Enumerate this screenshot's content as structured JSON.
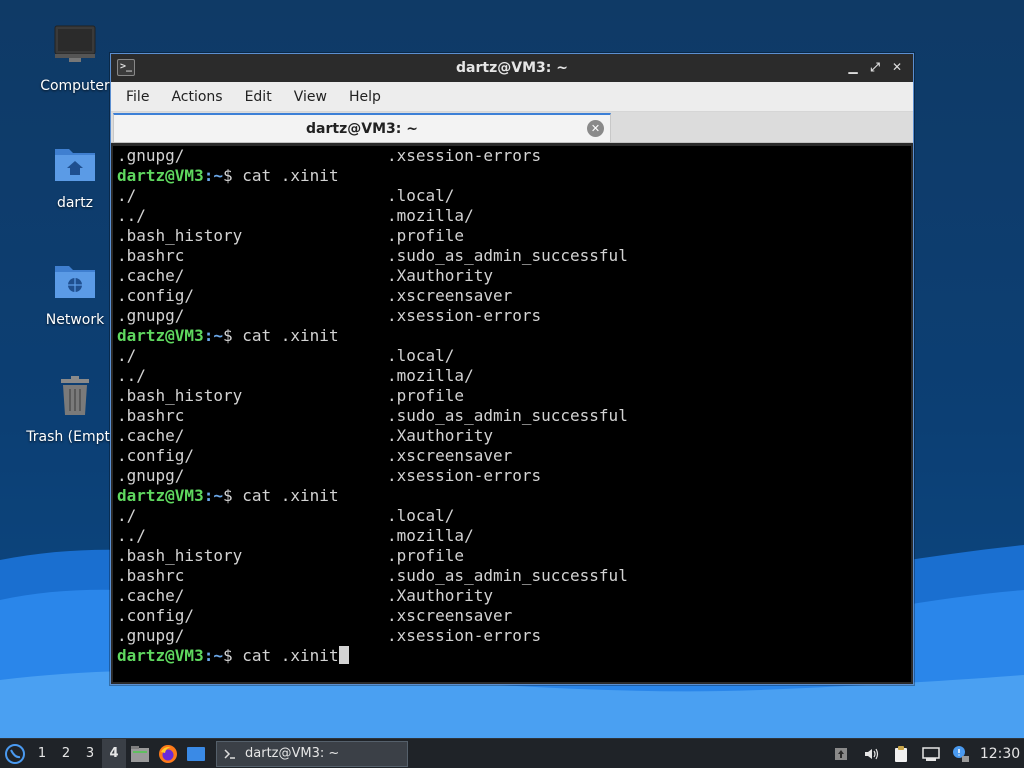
{
  "desktop": {
    "icons": [
      {
        "label": "Computer",
        "icon": "computer-icon"
      },
      {
        "label": "dartz",
        "icon": "home-folder-icon"
      },
      {
        "label": "Network",
        "icon": "network-folder-icon"
      },
      {
        "label": "Trash (Empty)",
        "icon": "trash-icon"
      }
    ]
  },
  "window": {
    "title": "dartz@VM3: ~",
    "buttons": {
      "minimize": "▁",
      "maximize": "⤢",
      "close": "✕"
    },
    "menu": [
      "File",
      "Actions",
      "Edit",
      "View",
      "Help"
    ],
    "tab": {
      "label": "dartz@VM3: ~",
      "close": "✕"
    }
  },
  "terminal": {
    "prompt_user": "dartz@VM3",
    "prompt_path": ":~",
    "prompt_symbol": "$",
    "command": " cat .xinit",
    "lines": [
      {
        "type": "out",
        "c1": ".gnupg/",
        "c2": ".xsession-errors"
      },
      {
        "type": "prompt"
      },
      {
        "type": "out",
        "c1": "./",
        "c2": ".local/"
      },
      {
        "type": "out",
        "c1": "../",
        "c2": ".mozilla/"
      },
      {
        "type": "out",
        "c1": ".bash_history",
        "c2": ".profile"
      },
      {
        "type": "out",
        "c1": ".bashrc",
        "c2": ".sudo_as_admin_successful"
      },
      {
        "type": "out",
        "c1": ".cache/",
        "c2": ".Xauthority"
      },
      {
        "type": "out",
        "c1": ".config/",
        "c2": ".xscreensaver"
      },
      {
        "type": "out",
        "c1": ".gnupg/",
        "c2": ".xsession-errors"
      },
      {
        "type": "prompt"
      },
      {
        "type": "out",
        "c1": "./",
        "c2": ".local/"
      },
      {
        "type": "out",
        "c1": "../",
        "c2": ".mozilla/"
      },
      {
        "type": "out",
        "c1": ".bash_history",
        "c2": ".profile"
      },
      {
        "type": "out",
        "c1": ".bashrc",
        "c2": ".sudo_as_admin_successful"
      },
      {
        "type": "out",
        "c1": ".cache/",
        "c2": ".Xauthority"
      },
      {
        "type": "out",
        "c1": ".config/",
        "c2": ".xscreensaver"
      },
      {
        "type": "out",
        "c1": ".gnupg/",
        "c2": ".xsession-errors"
      },
      {
        "type": "prompt"
      },
      {
        "type": "out",
        "c1": "./",
        "c2": ".local/"
      },
      {
        "type": "out",
        "c1": "../",
        "c2": ".mozilla/"
      },
      {
        "type": "out",
        "c1": ".bash_history",
        "c2": ".profile"
      },
      {
        "type": "out",
        "c1": ".bashrc",
        "c2": ".sudo_as_admin_successful"
      },
      {
        "type": "out",
        "c1": ".cache/",
        "c2": ".Xauthority"
      },
      {
        "type": "out",
        "c1": ".config/",
        "c2": ".xscreensaver"
      },
      {
        "type": "out",
        "c1": ".gnupg/",
        "c2": ".xsession-errors"
      },
      {
        "type": "prompt",
        "cursor": true
      }
    ]
  },
  "taskbar": {
    "workspaces": [
      "1",
      "2",
      "3",
      "4"
    ],
    "active_workspace": "4",
    "launchers": [
      "file-manager-icon",
      "firefox-icon",
      "show-desktop-icon"
    ],
    "task": {
      "label": "dartz@VM3: ~",
      "icon": "terminal-icon"
    },
    "tray": [
      "update-icon",
      "volume-icon",
      "clipboard-icon",
      "network-icon",
      "notification-icon"
    ],
    "clock": "12:30"
  },
  "colors": {
    "prompt_user": "#5fd75f",
    "prompt_path": "#6aa7e8",
    "accent": "#3c7fd6"
  }
}
